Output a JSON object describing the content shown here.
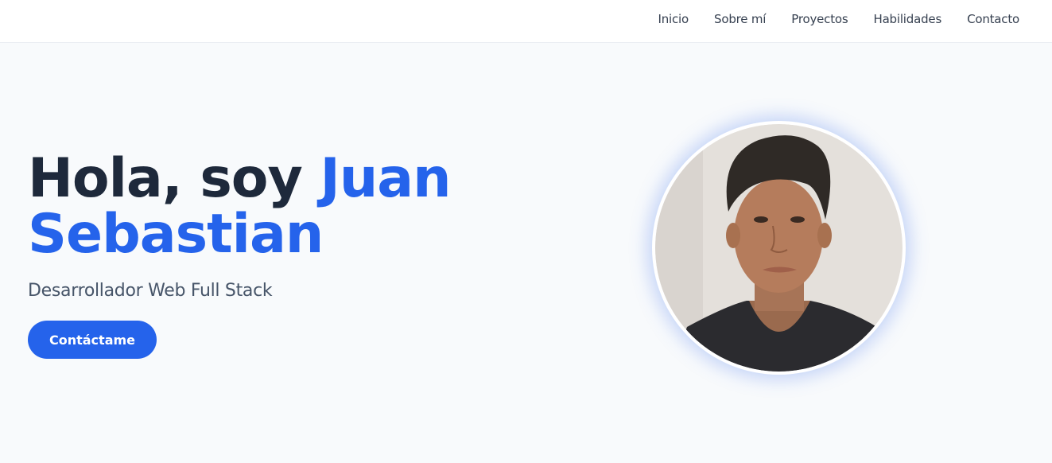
{
  "nav": {
    "items": [
      {
        "label": "Inicio"
      },
      {
        "label": "Sobre mí"
      },
      {
        "label": "Proyectos"
      },
      {
        "label": "Habilidades"
      },
      {
        "label": "Contacto"
      }
    ]
  },
  "hero": {
    "greeting": "Hola, soy ",
    "name_first": "Juan",
    "name_last": "Sebastian",
    "subtitle": "Desarrollador Web Full Stack",
    "cta_label": "Contáctame"
  },
  "colors": {
    "accent": "#2563eb",
    "heading": "#1e293b",
    "subtitle": "#475569",
    "background": "#f8fafc",
    "nav_bg": "#ffffff"
  }
}
